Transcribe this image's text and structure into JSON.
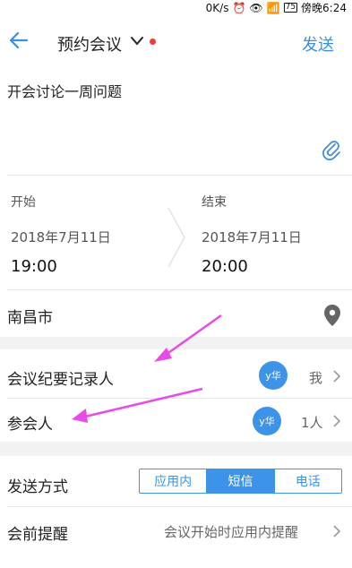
{
  "status_bar": {
    "net_speed": "0K/s",
    "battery": "75",
    "time": "傍晚6:24"
  },
  "header": {
    "title": "预约会议",
    "send_label": "发送"
  },
  "subject": "开会讨论一周问题",
  "time": {
    "start_label": "开始",
    "start_date": "2018年7月11日",
    "start_time": "19:00",
    "end_label": "结束",
    "end_date": "2018年7月11日",
    "end_time": "20:00"
  },
  "location": "南昌市",
  "recorder": {
    "label": "会议纪要记录人",
    "avatar_text": "y华",
    "value": "我"
  },
  "attendees": {
    "label": "参会人",
    "avatar_text": "y华",
    "value": "1人"
  },
  "send_method": {
    "label": "发送方式",
    "options": [
      "应用内",
      "短信",
      "电话"
    ],
    "selected": "短信"
  },
  "reminder": {
    "label": "会前提醒",
    "value": "会议开始时应用内提醒"
  },
  "colors": {
    "accent": "#3d93e8",
    "annotation": "#e84be8",
    "red_dot": "#ee3b3b"
  }
}
